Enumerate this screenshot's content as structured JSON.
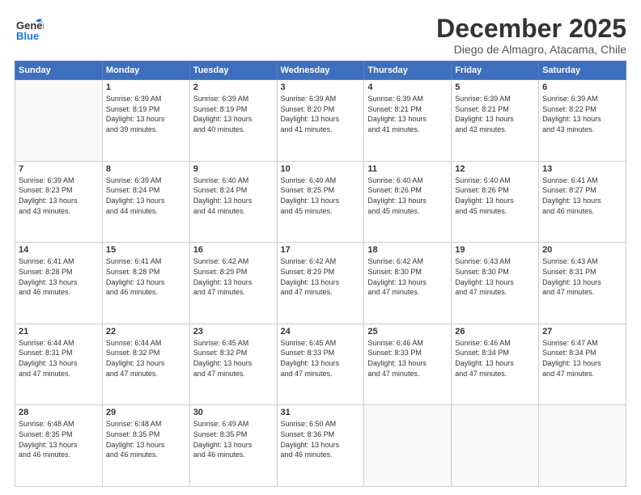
{
  "header": {
    "logo_line1": "General",
    "logo_line2": "Blue",
    "title": "December 2025",
    "subtitle": "Diego de Almagro, Atacama, Chile"
  },
  "days_of_week": [
    "Sunday",
    "Monday",
    "Tuesday",
    "Wednesday",
    "Thursday",
    "Friday",
    "Saturday"
  ],
  "weeks": [
    [
      {
        "num": "",
        "sunrise": "",
        "sunset": "",
        "daylight": ""
      },
      {
        "num": "1",
        "sunrise": "Sunrise: 6:39 AM",
        "sunset": "Sunset: 8:19 PM",
        "daylight": "Daylight: 13 hours and 39 minutes."
      },
      {
        "num": "2",
        "sunrise": "Sunrise: 6:39 AM",
        "sunset": "Sunset: 8:19 PM",
        "daylight": "Daylight: 13 hours and 40 minutes."
      },
      {
        "num": "3",
        "sunrise": "Sunrise: 6:39 AM",
        "sunset": "Sunset: 8:20 PM",
        "daylight": "Daylight: 13 hours and 41 minutes."
      },
      {
        "num": "4",
        "sunrise": "Sunrise: 6:39 AM",
        "sunset": "Sunset: 8:21 PM",
        "daylight": "Daylight: 13 hours and 41 minutes."
      },
      {
        "num": "5",
        "sunrise": "Sunrise: 6:39 AM",
        "sunset": "Sunset: 8:21 PM",
        "daylight": "Daylight: 13 hours and 42 minutes."
      },
      {
        "num": "6",
        "sunrise": "Sunrise: 6:39 AM",
        "sunset": "Sunset: 8:22 PM",
        "daylight": "Daylight: 13 hours and 43 minutes."
      }
    ],
    [
      {
        "num": "7",
        "sunrise": "Sunrise: 6:39 AM",
        "sunset": "Sunset: 8:23 PM",
        "daylight": "Daylight: 13 hours and 43 minutes."
      },
      {
        "num": "8",
        "sunrise": "Sunrise: 6:39 AM",
        "sunset": "Sunset: 8:24 PM",
        "daylight": "Daylight: 13 hours and 44 minutes."
      },
      {
        "num": "9",
        "sunrise": "Sunrise: 6:40 AM",
        "sunset": "Sunset: 8:24 PM",
        "daylight": "Daylight: 13 hours and 44 minutes."
      },
      {
        "num": "10",
        "sunrise": "Sunrise: 6:40 AM",
        "sunset": "Sunset: 8:25 PM",
        "daylight": "Daylight: 13 hours and 45 minutes."
      },
      {
        "num": "11",
        "sunrise": "Sunrise: 6:40 AM",
        "sunset": "Sunset: 8:26 PM",
        "daylight": "Daylight: 13 hours and 45 minutes."
      },
      {
        "num": "12",
        "sunrise": "Sunrise: 6:40 AM",
        "sunset": "Sunset: 8:26 PM",
        "daylight": "Daylight: 13 hours and 45 minutes."
      },
      {
        "num": "13",
        "sunrise": "Sunrise: 6:41 AM",
        "sunset": "Sunset: 8:27 PM",
        "daylight": "Daylight: 13 hours and 46 minutes."
      }
    ],
    [
      {
        "num": "14",
        "sunrise": "Sunrise: 6:41 AM",
        "sunset": "Sunset: 8:28 PM",
        "daylight": "Daylight: 13 hours and 46 minutes."
      },
      {
        "num": "15",
        "sunrise": "Sunrise: 6:41 AM",
        "sunset": "Sunset: 8:28 PM",
        "daylight": "Daylight: 13 hours and 46 minutes."
      },
      {
        "num": "16",
        "sunrise": "Sunrise: 6:42 AM",
        "sunset": "Sunset: 8:29 PM",
        "daylight": "Daylight: 13 hours and 47 minutes."
      },
      {
        "num": "17",
        "sunrise": "Sunrise: 6:42 AM",
        "sunset": "Sunset: 8:29 PM",
        "daylight": "Daylight: 13 hours and 47 minutes."
      },
      {
        "num": "18",
        "sunrise": "Sunrise: 6:42 AM",
        "sunset": "Sunset: 8:30 PM",
        "daylight": "Daylight: 13 hours and 47 minutes."
      },
      {
        "num": "19",
        "sunrise": "Sunrise: 6:43 AM",
        "sunset": "Sunset: 8:30 PM",
        "daylight": "Daylight: 13 hours and 47 minutes."
      },
      {
        "num": "20",
        "sunrise": "Sunrise: 6:43 AM",
        "sunset": "Sunset: 8:31 PM",
        "daylight": "Daylight: 13 hours and 47 minutes."
      }
    ],
    [
      {
        "num": "21",
        "sunrise": "Sunrise: 6:44 AM",
        "sunset": "Sunset: 8:31 PM",
        "daylight": "Daylight: 13 hours and 47 minutes."
      },
      {
        "num": "22",
        "sunrise": "Sunrise: 6:44 AM",
        "sunset": "Sunset: 8:32 PM",
        "daylight": "Daylight: 13 hours and 47 minutes."
      },
      {
        "num": "23",
        "sunrise": "Sunrise: 6:45 AM",
        "sunset": "Sunset: 8:32 PM",
        "daylight": "Daylight: 13 hours and 47 minutes."
      },
      {
        "num": "24",
        "sunrise": "Sunrise: 6:45 AM",
        "sunset": "Sunset: 8:33 PM",
        "daylight": "Daylight: 13 hours and 47 minutes."
      },
      {
        "num": "25",
        "sunrise": "Sunrise: 6:46 AM",
        "sunset": "Sunset: 8:33 PM",
        "daylight": "Daylight: 13 hours and 47 minutes."
      },
      {
        "num": "26",
        "sunrise": "Sunrise: 6:46 AM",
        "sunset": "Sunset: 8:34 PM",
        "daylight": "Daylight: 13 hours and 47 minutes."
      },
      {
        "num": "27",
        "sunrise": "Sunrise: 6:47 AM",
        "sunset": "Sunset: 8:34 PM",
        "daylight": "Daylight: 13 hours and 47 minutes."
      }
    ],
    [
      {
        "num": "28",
        "sunrise": "Sunrise: 6:48 AM",
        "sunset": "Sunset: 8:35 PM",
        "daylight": "Daylight: 13 hours and 46 minutes."
      },
      {
        "num": "29",
        "sunrise": "Sunrise: 6:48 AM",
        "sunset": "Sunset: 8:35 PM",
        "daylight": "Daylight: 13 hours and 46 minutes."
      },
      {
        "num": "30",
        "sunrise": "Sunrise: 6:49 AM",
        "sunset": "Sunset: 8:35 PM",
        "daylight": "Daylight: 13 hours and 46 minutes."
      },
      {
        "num": "31",
        "sunrise": "Sunrise: 6:50 AM",
        "sunset": "Sunset: 8:36 PM",
        "daylight": "Daylight: 13 hours and 46 minutes."
      },
      {
        "num": "",
        "sunrise": "",
        "sunset": "",
        "daylight": ""
      },
      {
        "num": "",
        "sunrise": "",
        "sunset": "",
        "daylight": ""
      },
      {
        "num": "",
        "sunrise": "",
        "sunset": "",
        "daylight": ""
      }
    ]
  ]
}
